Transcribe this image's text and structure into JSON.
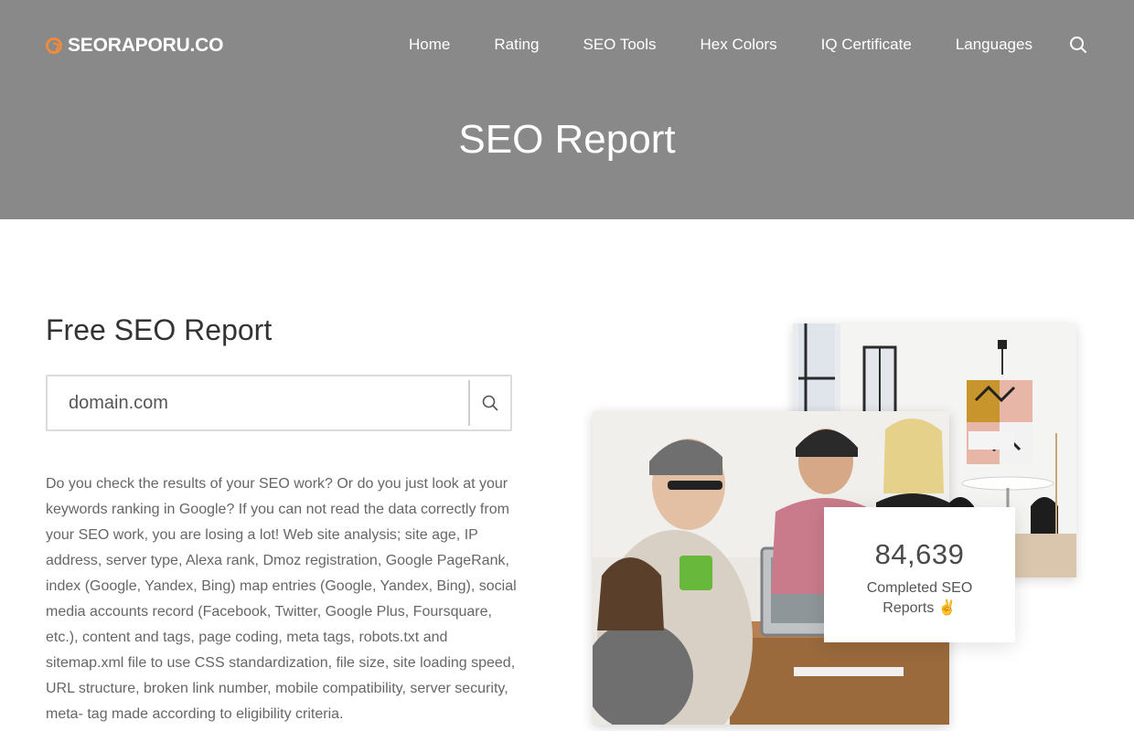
{
  "site": {
    "logo_text": "SEORAPORU.CO"
  },
  "nav": {
    "items": [
      "Home",
      "Rating",
      "SEO Tools",
      "Hex Colors",
      "IQ Certificate",
      "Languages"
    ]
  },
  "header": {
    "title": "SEO Report"
  },
  "main": {
    "section_title": "Free SEO Report",
    "search": {
      "placeholder": "domain.com"
    },
    "description": "Do you check the results of your SEO work? Or do you just look at your keywords ranking in Google? If you can not read the data correctly from your SEO work, you are losing a lot! Web site analysis; site age, IP address, server type, Alexa rank, Dmoz registration, Google PageRank, index (Google, Yandex, Bing) map entries (Google, Yandex, Bing), social media accounts record (Facebook, Twitter, Google Plus, Foursquare, etc.), content and tags, page coding, meta tags, robots.txt and sitemap.xml file to use CSS standardization, file size, site loading speed, URL structure, broken link number, mobile compatibility, server security, meta- tag made according to eligibility criteria."
  },
  "stats": {
    "count": "84,639",
    "label": "Completed SEO Reports ✌️"
  },
  "colors": {
    "header_bg": "#898989",
    "logo_accent": "#f08a3c",
    "text_dark": "#333333",
    "text_body": "#666666"
  },
  "icons": {
    "logo": "logo-mark-icon",
    "nav_search": "search-icon",
    "input_search": "search-icon"
  }
}
